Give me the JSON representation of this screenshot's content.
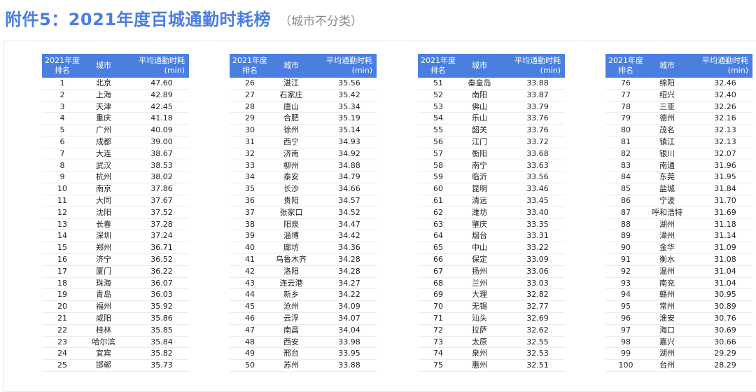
{
  "title": {
    "main": "附件5：2021年度百城通勤时耗榜",
    "sub": "（城市不分类）"
  },
  "table_header": {
    "rank_l1": "2021年度",
    "rank_l2": "排名",
    "city": "城市",
    "value_l1": "平均通勤时耗",
    "value_l2": "(min)"
  },
  "tables": [
    {
      "rows": [
        {
          "rank": "1",
          "city": "北京",
          "value": "47.60"
        },
        {
          "rank": "2",
          "city": "上海",
          "value": "42.89"
        },
        {
          "rank": "3",
          "city": "天津",
          "value": "42.45"
        },
        {
          "rank": "4",
          "city": "重庆",
          "value": "41.18"
        },
        {
          "rank": "5",
          "city": "广州",
          "value": "40.09"
        },
        {
          "rank": "6",
          "city": "成都",
          "value": "39.00"
        },
        {
          "rank": "7",
          "city": "大连",
          "value": "38.67"
        },
        {
          "rank": "8",
          "city": "武汉",
          "value": "38.53"
        },
        {
          "rank": "9",
          "city": "杭州",
          "value": "38.02"
        },
        {
          "rank": "10",
          "city": "南京",
          "value": "37.86"
        },
        {
          "rank": "11",
          "city": "大同",
          "value": "37.67"
        },
        {
          "rank": "12",
          "city": "沈阳",
          "value": "37.52"
        },
        {
          "rank": "13",
          "city": "长春",
          "value": "37.28"
        },
        {
          "rank": "14",
          "city": "深圳",
          "value": "37.24"
        },
        {
          "rank": "15",
          "city": "郑州",
          "value": "36.71"
        },
        {
          "rank": "16",
          "city": "济宁",
          "value": "36.52"
        },
        {
          "rank": "17",
          "city": "厦门",
          "value": "36.22"
        },
        {
          "rank": "18",
          "city": "珠海",
          "value": "36.07"
        },
        {
          "rank": "19",
          "city": "青岛",
          "value": "36.03"
        },
        {
          "rank": "20",
          "city": "福州",
          "value": "35.92"
        },
        {
          "rank": "21",
          "city": "咸阳",
          "value": "35.86"
        },
        {
          "rank": "22",
          "city": "桂林",
          "value": "35.85"
        },
        {
          "rank": "23",
          "city": "哈尔滨",
          "value": "35.84"
        },
        {
          "rank": "24",
          "city": "宜宾",
          "value": "35.82"
        },
        {
          "rank": "25",
          "city": "邯郸",
          "value": "35.73"
        }
      ]
    },
    {
      "rows": [
        {
          "rank": "26",
          "city": "湛江",
          "value": "35.56"
        },
        {
          "rank": "27",
          "city": "石家庄",
          "value": "35.42"
        },
        {
          "rank": "28",
          "city": "唐山",
          "value": "35.34"
        },
        {
          "rank": "29",
          "city": "合肥",
          "value": "35.19"
        },
        {
          "rank": "30",
          "city": "徐州",
          "value": "35.14"
        },
        {
          "rank": "31",
          "city": "西宁",
          "value": "34.93"
        },
        {
          "rank": "32",
          "city": "济南",
          "value": "34.92"
        },
        {
          "rank": "33",
          "city": "柳州",
          "value": "34.88"
        },
        {
          "rank": "34",
          "city": "泰安",
          "value": "34.79"
        },
        {
          "rank": "35",
          "city": "长沙",
          "value": "34.66"
        },
        {
          "rank": "36",
          "city": "贵阳",
          "value": "34.57"
        },
        {
          "rank": "37",
          "city": "张家口",
          "value": "34.52"
        },
        {
          "rank": "38",
          "city": "阳泉",
          "value": "34.47"
        },
        {
          "rank": "39",
          "city": "淄博",
          "value": "34.42"
        },
        {
          "rank": "40",
          "city": "廊坊",
          "value": "34.36"
        },
        {
          "rank": "41",
          "city": "乌鲁木齐",
          "value": "34.28"
        },
        {
          "rank": "42",
          "city": "洛阳",
          "value": "34.28"
        },
        {
          "rank": "43",
          "city": "连云港",
          "value": "34.27"
        },
        {
          "rank": "44",
          "city": "新乡",
          "value": "34.22"
        },
        {
          "rank": "45",
          "city": "沧州",
          "value": "34.09"
        },
        {
          "rank": "46",
          "city": "云浮",
          "value": "34.07"
        },
        {
          "rank": "47",
          "city": "南昌",
          "value": "34.04"
        },
        {
          "rank": "48",
          "city": "西安",
          "value": "33.98"
        },
        {
          "rank": "49",
          "city": "邢台",
          "value": "33.95"
        },
        {
          "rank": "50",
          "city": "苏州",
          "value": "33.88"
        }
      ]
    },
    {
      "rows": [
        {
          "rank": "51",
          "city": "秦皇岛",
          "value": "33.88"
        },
        {
          "rank": "52",
          "city": "南阳",
          "value": "33.87"
        },
        {
          "rank": "53",
          "city": "佛山",
          "value": "33.79"
        },
        {
          "rank": "54",
          "city": "乐山",
          "value": "33.76"
        },
        {
          "rank": "55",
          "city": "韶关",
          "value": "33.76"
        },
        {
          "rank": "56",
          "city": "江门",
          "value": "33.72"
        },
        {
          "rank": "57",
          "city": "衡阳",
          "value": "33.68"
        },
        {
          "rank": "58",
          "city": "南宁",
          "value": "33.63"
        },
        {
          "rank": "59",
          "city": "临沂",
          "value": "33.56"
        },
        {
          "rank": "60",
          "city": "昆明",
          "value": "33.46"
        },
        {
          "rank": "61",
          "city": "清远",
          "value": "33.45"
        },
        {
          "rank": "62",
          "city": "潍坊",
          "value": "33.40"
        },
        {
          "rank": "63",
          "city": "肇庆",
          "value": "33.35"
        },
        {
          "rank": "64",
          "city": "烟台",
          "value": "33.31"
        },
        {
          "rank": "65",
          "city": "中山",
          "value": "33.22"
        },
        {
          "rank": "66",
          "city": "保定",
          "value": "33.09"
        },
        {
          "rank": "67",
          "city": "扬州",
          "value": "33.06"
        },
        {
          "rank": "68",
          "city": "兰州",
          "value": "33.03"
        },
        {
          "rank": "69",
          "city": "大理",
          "value": "32.82"
        },
        {
          "rank": "70",
          "city": "无锡",
          "value": "32.77"
        },
        {
          "rank": "71",
          "city": "汕头",
          "value": "32.69"
        },
        {
          "rank": "72",
          "city": "拉萨",
          "value": "32.62"
        },
        {
          "rank": "73",
          "city": "太原",
          "value": "32.55"
        },
        {
          "rank": "74",
          "city": "泉州",
          "value": "32.53"
        },
        {
          "rank": "75",
          "city": "惠州",
          "value": "32.51"
        }
      ]
    },
    {
      "rows": [
        {
          "rank": "76",
          "city": "绵阳",
          "value": "32.46"
        },
        {
          "rank": "77",
          "city": "绍兴",
          "value": "32.40"
        },
        {
          "rank": "78",
          "city": "三亚",
          "value": "32.26"
        },
        {
          "rank": "79",
          "city": "德州",
          "value": "32.16"
        },
        {
          "rank": "80",
          "city": "茂名",
          "value": "32.13"
        },
        {
          "rank": "81",
          "city": "镇江",
          "value": "32.13"
        },
        {
          "rank": "82",
          "city": "银川",
          "value": "32.07"
        },
        {
          "rank": "83",
          "city": "南通",
          "value": "31.96"
        },
        {
          "rank": "84",
          "city": "东莞",
          "value": "31.95"
        },
        {
          "rank": "85",
          "city": "盐城",
          "value": "31.84"
        },
        {
          "rank": "86",
          "city": "宁波",
          "value": "31.70"
        },
        {
          "rank": "87",
          "city": "呼和浩特",
          "value": "31.69"
        },
        {
          "rank": "88",
          "city": "湖州",
          "value": "31.18"
        },
        {
          "rank": "89",
          "city": "漳州",
          "value": "31.14"
        },
        {
          "rank": "90",
          "city": "金华",
          "value": "31.09"
        },
        {
          "rank": "91",
          "city": "衡水",
          "value": "31.08"
        },
        {
          "rank": "92",
          "city": "温州",
          "value": "31.04"
        },
        {
          "rank": "93",
          "city": "南充",
          "value": "31.04"
        },
        {
          "rank": "94",
          "city": "赣州",
          "value": "30.95"
        },
        {
          "rank": "95",
          "city": "常州",
          "value": "30.89"
        },
        {
          "rank": "96",
          "city": "淮安",
          "value": "30.76"
        },
        {
          "rank": "97",
          "city": "海口",
          "value": "30.69"
        },
        {
          "rank": "98",
          "city": "嘉兴",
          "value": "30.66"
        },
        {
          "rank": "99",
          "city": "湖州",
          "value": "29.29"
        },
        {
          "rank": "100",
          "city": "台州",
          "value": "28.29"
        }
      ]
    }
  ],
  "colors": {
    "accent": "#4a7fe0",
    "subtitle": "#8a8a8a"
  }
}
